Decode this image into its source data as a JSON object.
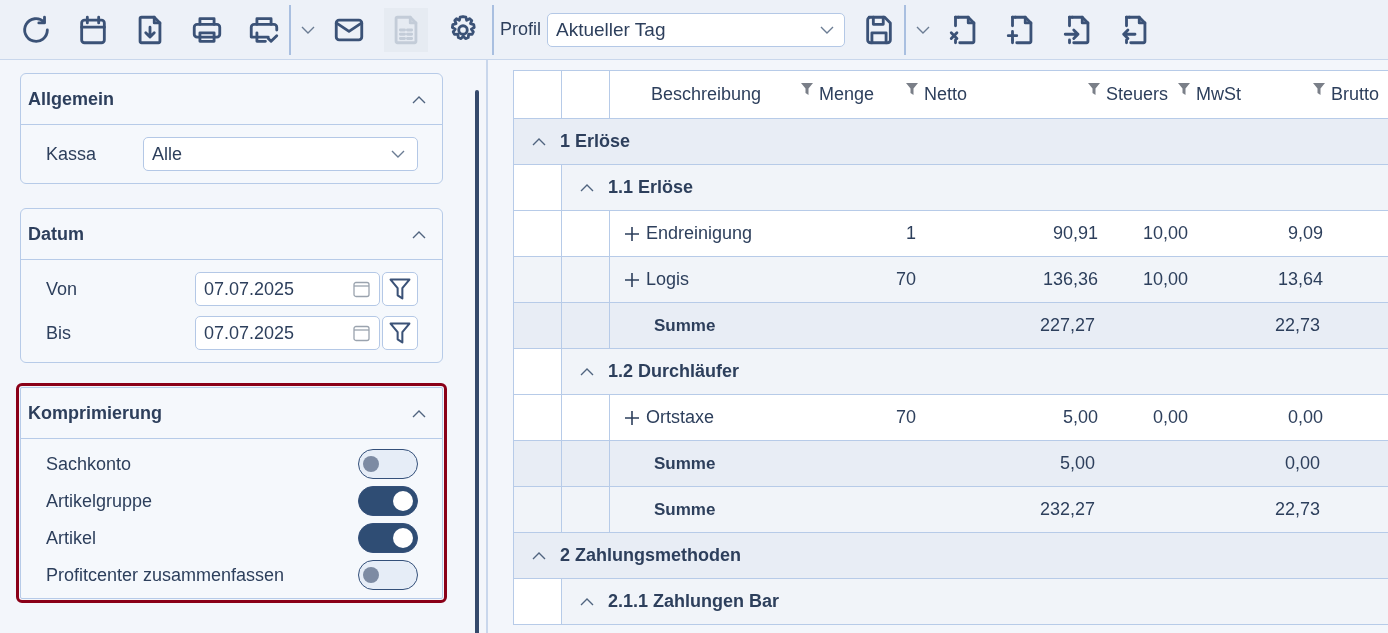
{
  "toolbar": {
    "buttons": [
      {
        "disabled": false
      },
      {
        "disabled": false
      },
      {
        "disabled": false
      },
      {
        "disabled": false
      },
      {
        "disabled": false
      },
      {
        "disabled": false
      },
      {
        "disabled": true
      },
      {
        "disabled": false
      }
    ],
    "profile": {
      "label": "Profil",
      "value": "Aktueller Tag"
    },
    "profile_buttons": [
      {
        "disabled": false
      },
      {
        "disabled": false
      },
      {
        "disabled": false
      },
      {
        "disabled": false
      },
      {
        "disabled": false
      }
    ]
  },
  "sidebar": {
    "sections": [
      {
        "kind": "select",
        "title": "Allgemein",
        "expanded": true,
        "highlighted": false,
        "fields": [
          {
            "label": "Kassa",
            "value": "Alle"
          }
        ]
      },
      {
        "kind": "dates",
        "title": "Datum",
        "expanded": true,
        "highlighted": false,
        "fields": [
          {
            "label": "Von",
            "value": "07.07.2025"
          },
          {
            "label": "Bis",
            "value": "07.07.2025"
          }
        ]
      },
      {
        "kind": "toggles",
        "title": "Komprimierung",
        "expanded": true,
        "highlighted": true,
        "fields": [
          {
            "label": "Sachkonto",
            "on": false
          },
          {
            "label": "Artikelgruppe",
            "on": true
          },
          {
            "label": "Artikel",
            "on": true
          },
          {
            "label": "Profitcenter zusammenfassen",
            "on": false
          }
        ]
      }
    ]
  },
  "table": {
    "columns": [
      {
        "label": "Beschreibung"
      },
      {
        "label": "Menge"
      },
      {
        "label": "Netto"
      },
      {
        "label": "Steuers"
      },
      {
        "label": "MwSt"
      },
      {
        "label": "Brutto"
      }
    ],
    "rows": [
      {
        "kind": "group",
        "label": "1 Erlöse",
        "expanded": true,
        "children": [
          {
            "kind": "group",
            "label": "1.1 Erlöse",
            "expanded": true,
            "children": [
              {
                "kind": "item",
                "expanded": false,
                "cells": [
                  "Endreinigung",
                  "1",
                  "90,91",
                  "10,00",
                  "9,09"
                ]
              },
              {
                "kind": "item",
                "expanded": false,
                "cells": [
                  "Logis",
                  "70",
                  "136,36",
                  "10,00",
                  "13,64"
                ]
              },
              {
                "kind": "sum",
                "cells": [
                  "Summe",
                  "",
                  "227,27",
                  "",
                  "22,73"
                ]
              }
            ]
          },
          {
            "kind": "group",
            "label": "1.2 Durchläufer",
            "expanded": true,
            "children": [
              {
                "kind": "item",
                "expanded": false,
                "cells": [
                  "Ortstaxe",
                  "70",
                  "5,00",
                  "0,00",
                  "0,00"
                ]
              },
              {
                "kind": "sum",
                "cells": [
                  "Summe",
                  "",
                  "5,00",
                  "",
                  "0,00"
                ]
              }
            ]
          },
          {
            "kind": "sum",
            "cells": [
              "Summe",
              "",
              "232,27",
              "",
              "22,73"
            ]
          }
        ]
      },
      {
        "kind": "group",
        "label": "2 Zahlungsmethoden",
        "expanded": true,
        "children": [
          {
            "kind": "group",
            "label": "2.1.1 Zahlungen Bar",
            "expanded": true
          }
        ]
      }
    ]
  }
}
